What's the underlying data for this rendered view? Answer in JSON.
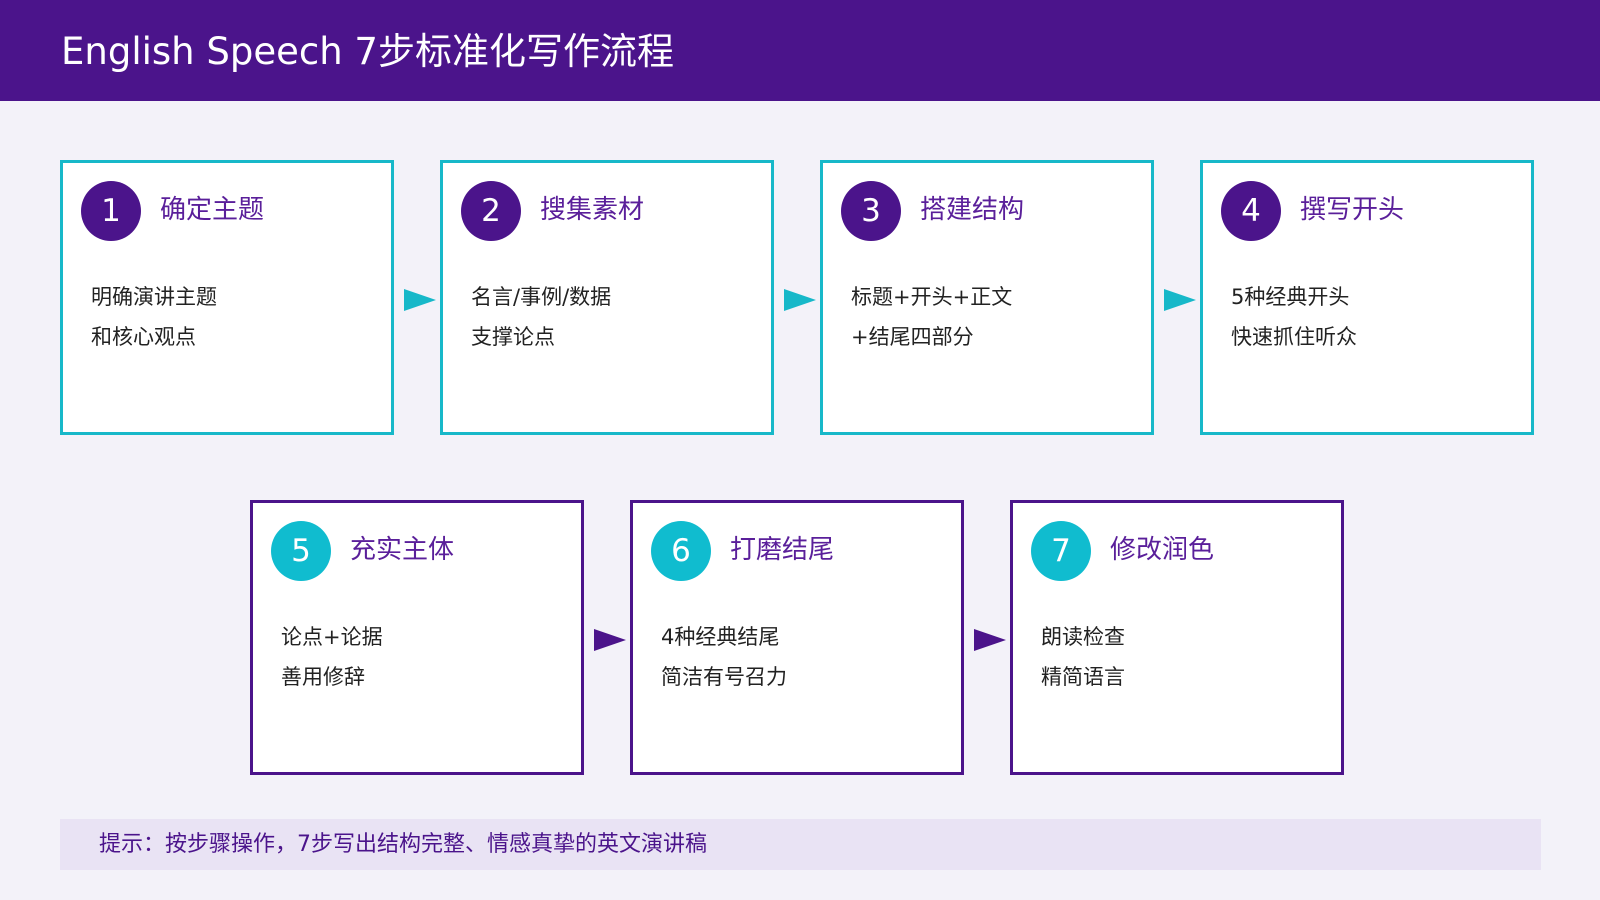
{
  "header": {
    "title": "English Speech 7步标准化写作流程"
  },
  "steps": [
    {
      "number": "1",
      "title": "确定主题",
      "lines": [
        "明确演讲主题",
        "和核心观点"
      ]
    },
    {
      "number": "2",
      "title": "搜集素材",
      "lines": [
        "名言/事例/数据",
        "支撑论点"
      ]
    },
    {
      "number": "3",
      "title": "搭建结构",
      "lines": [
        "标题+开头+正文",
        "+结尾四部分"
      ]
    },
    {
      "number": "4",
      "title": "撰写开头",
      "lines": [
        "5种经典开头",
        "快速抓住听众"
      ]
    },
    {
      "number": "5",
      "title": "充实主体",
      "lines": [
        "论点+论据",
        "善用修辞"
      ]
    },
    {
      "number": "6",
      "title": "打磨结尾",
      "lines": [
        "4种经典结尾",
        "简洁有号召力"
      ]
    },
    {
      "number": "7",
      "title": "修改润色",
      "lines": [
        "朗读检查",
        "精简语言"
      ]
    }
  ],
  "tip": "提示：按步骤操作，7步写出结构完整、情感真挚的英文演讲稿",
  "colors": {
    "primary_purple": "#4b148b",
    "accent_teal": "#17b8c9",
    "background": "#f3f2f9",
    "tip_background": "#e9e3f4"
  },
  "icons": {
    "connector": "right-arrow-triangle"
  }
}
